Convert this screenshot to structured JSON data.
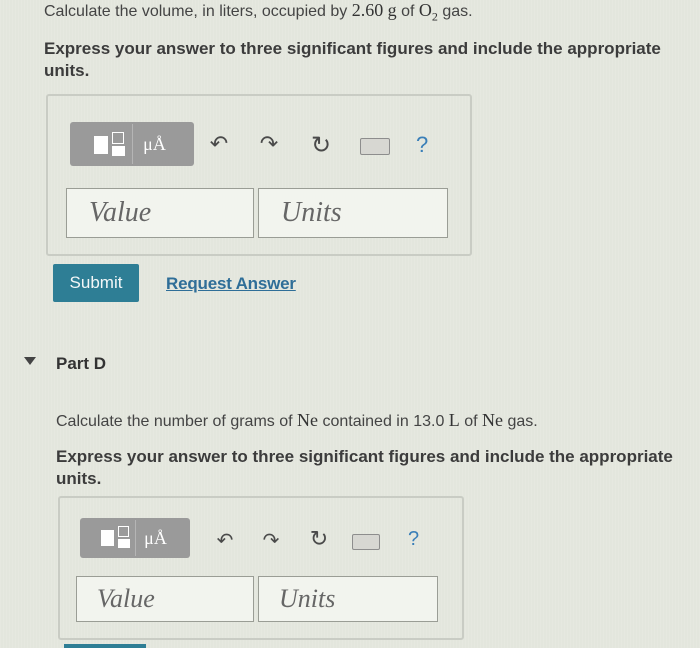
{
  "part_c": {
    "question_prefix": "Calculate the volume, in liters, occupied by ",
    "question_amount": "2.60",
    "question_unit": "g",
    "question_of": " of ",
    "question_formula": "O",
    "question_subscript": "2",
    "question_suffix": " gas.",
    "instruction": "Express your answer to three significant figures and include the appropriate units.",
    "value_placeholder": "Value",
    "units_placeholder": "Units",
    "submit_label": "Submit",
    "request_answer_label": "Request Answer"
  },
  "part_d": {
    "title": "Part D",
    "question_prefix": "Calculate the number of grams of ",
    "question_element1": "Ne",
    "question_middle": " contained in 13.0 ",
    "question_unit": "L",
    "question_of": " of ",
    "question_element2": "Ne",
    "question_suffix": " gas.",
    "instruction": "Express your answer to three significant figures and include the appropriate units.",
    "value_placeholder": "Value",
    "units_placeholder": "Units"
  },
  "toolbar": {
    "units_symbol": "μÅ",
    "undo_glyph": "↶",
    "redo_glyph": "↷",
    "reset_glyph": "↻",
    "help_glyph": "?"
  },
  "icons": {
    "templates": "templates-icon",
    "units": "units-icon",
    "undo": "undo-icon",
    "redo": "redo-icon",
    "reset": "reset-icon",
    "keyboard": "keyboard-icon",
    "help": "help-icon",
    "collapse": "collapse-triangle-icon"
  },
  "colors": {
    "submit_bg": "#2e7e95",
    "link": "#2f6e98",
    "help": "#3a7fb8",
    "toolbar": "#9a9a9a"
  }
}
